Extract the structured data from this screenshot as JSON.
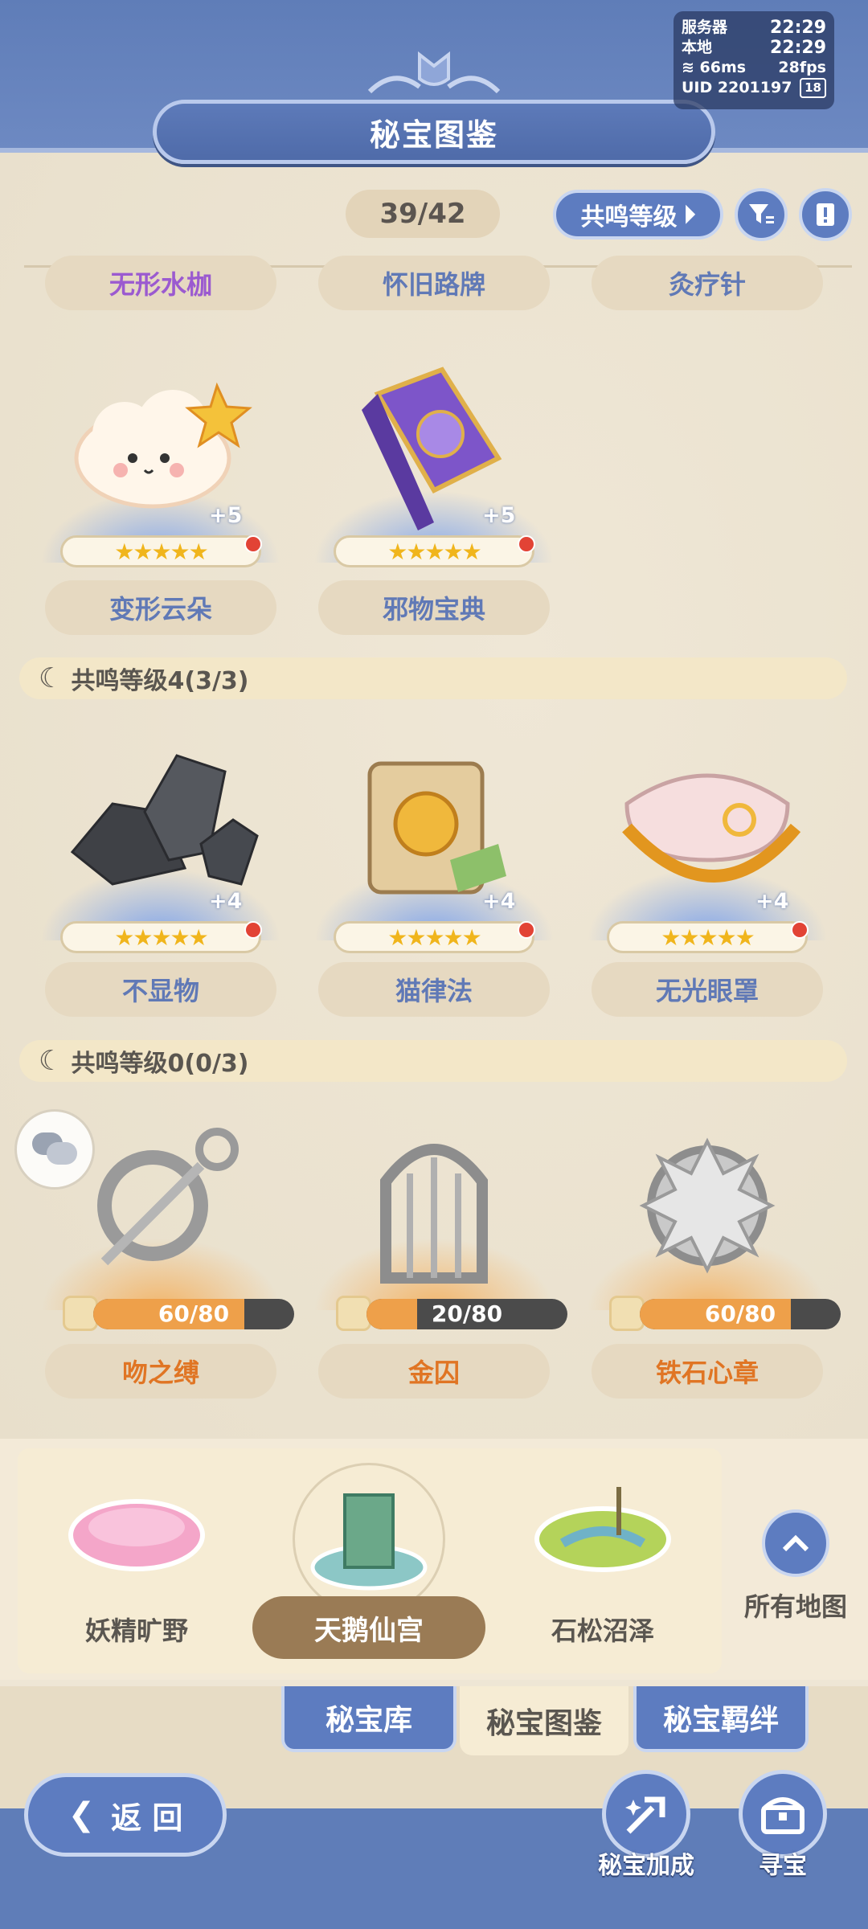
{
  "status": {
    "server_label": "服务器",
    "server_time": "22:29",
    "local_label": "本地",
    "local_time": "22:29",
    "ping": "66ms",
    "fps": "28fps",
    "uid": "UID 2201197",
    "age": "18"
  },
  "header": {
    "title": "秘宝图鉴"
  },
  "toolbar": {
    "count": "39/42",
    "sort_label": "共鸣等级",
    "filter_icon": "filter-icon",
    "book_icon": "book-icon"
  },
  "top_row_labels": [
    "无形水枷",
    "怀旧路牌",
    "灸疗针"
  ],
  "group_a_items": [
    {
      "name": "变形云朵",
      "plus": "+5",
      "stars": "★★★★★",
      "has_dot": true
    },
    {
      "name": "邪物宝典",
      "plus": "+5",
      "stars": "★★★★★",
      "has_dot": true
    }
  ],
  "section_4": {
    "label": "共鸣等级4(3/3)"
  },
  "group_b_items": [
    {
      "name": "不显物",
      "plus": "+4",
      "stars": "★★★★★",
      "has_dot": true
    },
    {
      "name": "猫律法",
      "plus": "+4",
      "stars": "★★★★★",
      "has_dot": true
    },
    {
      "name": "无光眼罩",
      "plus": "+4",
      "stars": "★★★★★",
      "has_dot": true
    }
  ],
  "section_0": {
    "label": "共鸣等级0(0/3)"
  },
  "group_c_items": [
    {
      "name": "吻之缚",
      "progress": "60/80",
      "fraction": 0.75
    },
    {
      "name": "金囚",
      "progress": "20/80",
      "fraction": 0.25
    },
    {
      "name": "铁石心章",
      "progress": "60/80",
      "fraction": 0.75
    }
  ],
  "maps": [
    {
      "name": "妖精旷野",
      "selected": false
    },
    {
      "name": "天鹅仙宫",
      "selected": true
    },
    {
      "name": "石松沼泽",
      "selected": false
    }
  ],
  "all_maps_label": "所有地图",
  "tabs": [
    {
      "label": "秘宝库",
      "active": false
    },
    {
      "label": "秘宝图鉴",
      "active": true
    },
    {
      "label": "秘宝羁绊",
      "active": false
    }
  ],
  "nav": {
    "back_label": "返 回",
    "boost_label": "秘宝加成",
    "hunt_label": "寻宝"
  },
  "colors": {
    "primary_blue": "#5d7cc0",
    "header_blue": "#5f7db8",
    "orange": "#e07524",
    "purple": "#9b5ad0",
    "red_dot": "#e24335"
  }
}
